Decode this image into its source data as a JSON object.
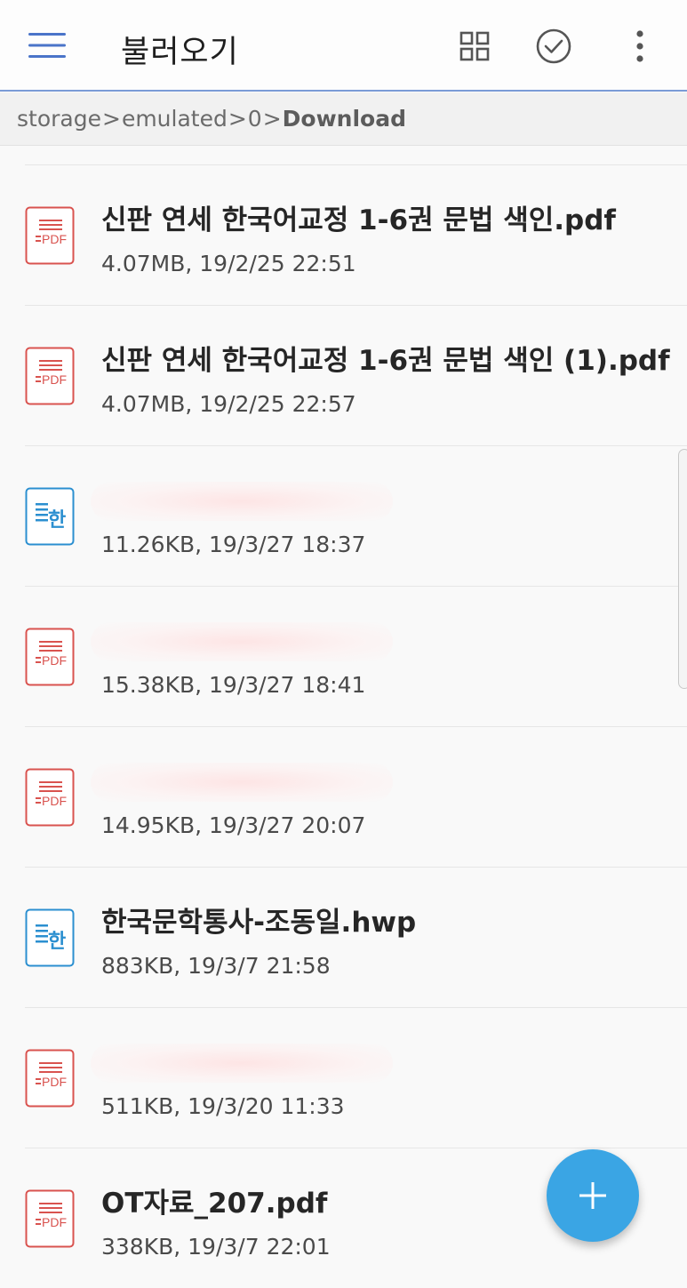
{
  "appbar": {
    "title": "불러오기",
    "menu_icon": "hamburger-menu-icon",
    "actions": [
      "grid-view-icon",
      "select-check-icon",
      "more-options-icon"
    ],
    "accent_color": "#7b9bd6"
  },
  "breadcrumb": {
    "crumbs": [
      "storage",
      "emulated",
      "0"
    ],
    "separator": ">",
    "current": "Download"
  },
  "files": [
    {
      "type": "pdf",
      "name": "신판 연세 한국어교정 1-6권 문법 색인.pdf",
      "meta": "4.07MB, 19/2/25 22:51"
    },
    {
      "type": "pdf",
      "name": "신판 연세 한국어교정 1-6권 문법 색인 (1).pdf",
      "meta": "4.07MB, 19/2/25 22:57"
    },
    {
      "type": "hwp",
      "name": "",
      "meta": "11.26KB, 19/3/27 18:37",
      "redacted": true
    },
    {
      "type": "pdf",
      "name": "",
      "meta": "15.38KB, 19/3/27 18:41",
      "redacted": true
    },
    {
      "type": "pdf",
      "name": "",
      "meta": "14.95KB, 19/3/27 20:07",
      "redacted": true
    },
    {
      "type": "hwp",
      "name": "한국문학통사-조동일.hwp",
      "meta": "883KB, 19/3/7 21:58"
    },
    {
      "type": "pdf",
      "name": "",
      "meta": "511KB, 19/3/20 11:33",
      "redacted": true
    },
    {
      "type": "pdf",
      "name": "OT자료_207.pdf",
      "meta": "338KB, 19/3/7 22:01"
    }
  ],
  "icons": {
    "pdf": {
      "name": "pdf-file-icon",
      "color": "#d9534f",
      "label": "PDF"
    },
    "hwp": {
      "name": "hwp-file-icon",
      "color": "#2b8fd0",
      "label": "한"
    }
  },
  "fab": {
    "icon": "plus-icon",
    "color": "#3aa5e4"
  }
}
